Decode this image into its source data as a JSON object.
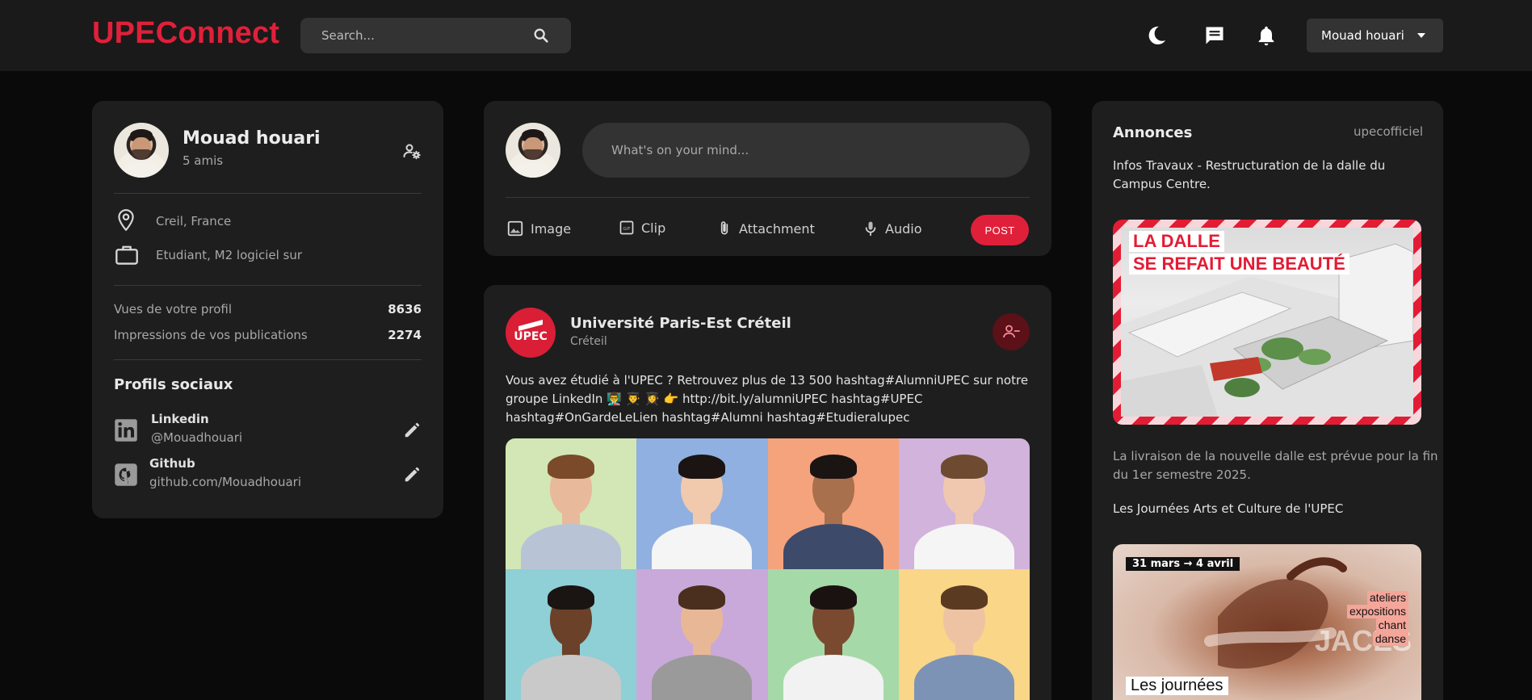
{
  "nav": {
    "brand": "UPEConnect",
    "search_placeholder": "Search...",
    "user_name": "Mouad houari",
    "icons": [
      "moon-icon",
      "message-icon",
      "bell-icon"
    ]
  },
  "profile": {
    "name": "Mouad houari",
    "friends": "5 amis",
    "location": "Creil, France",
    "occupation": "Etudiant, M2 logiciel sur",
    "stats": [
      {
        "label": "Vues de votre profil",
        "value": "8636"
      },
      {
        "label": "Impressions de vos publications",
        "value": "2274"
      }
    ],
    "social_title": "Profils sociaux",
    "socials": [
      {
        "name": "Linkedin",
        "handle": "@Mouadhouari",
        "icon": "linkedin-icon"
      },
      {
        "name": "Github",
        "handle": "github.com/Mouadhouari",
        "icon": "github-icon"
      }
    ]
  },
  "composer": {
    "placeholder": "What's on your mind...",
    "actions": [
      {
        "label": "Image",
        "icon": "image-icon"
      },
      {
        "label": "Clip",
        "icon": "gif-icon"
      },
      {
        "label": "Attachment",
        "icon": "paperclip-icon"
      },
      {
        "label": "Audio",
        "icon": "microphone-icon"
      }
    ],
    "post_label": "POST"
  },
  "post": {
    "author": "Université Paris-Est Créteil",
    "location": "Créteil",
    "logo_text": "UPEC",
    "text_line1": "Vous avez étudié à l'UPEC ? Retrouvez plus de 13 500 hashtag#AlumniUPEC sur notre",
    "text_line2": "groupe LinkedIn 👨‍🏫 👨‍🎓 👩‍🎓 👉 http://bit.ly/alumniUPEC hashtag#UPEC",
    "text_line3": "hashtag#OnGardeLeLien hashtag#Alumni hashtag#Etudieralupec",
    "tile_colors": [
      "#d2e7b5",
      "#8fb0e0",
      "#f4a37d",
      "#d1b3db",
      "#8fcfd6",
      "#c9a9d9",
      "#a6d9a8",
      "#f9d688"
    ]
  },
  "announcements": {
    "title": "Annonces",
    "source": "upecofficiel",
    "item1_line1": "Infos Travaux - Restructuration de la dalle du",
    "item1_line2": "Campus Centre.",
    "dalle_line1": "LA DALLE",
    "dalle_line2": "SE REFAIT UNE BEAUTÉ",
    "desc_line1": "La livraison de la nouvelle dalle est prévue pour la fin",
    "desc_line2": "du 1er semestre 2025.",
    "item2": "Les Journées Arts et Culture de l'UPEC",
    "jaac_date": "31 mars → 4 avril",
    "jaac_tags": [
      "ateliers",
      "expositions",
      "chant",
      "danse"
    ],
    "jaac_bottom": "Les journées"
  },
  "colors": {
    "brand": "#e0203a",
    "background": "#0a0a0a",
    "card": "#1e1e1e",
    "navbar": "#1a1a1a"
  }
}
